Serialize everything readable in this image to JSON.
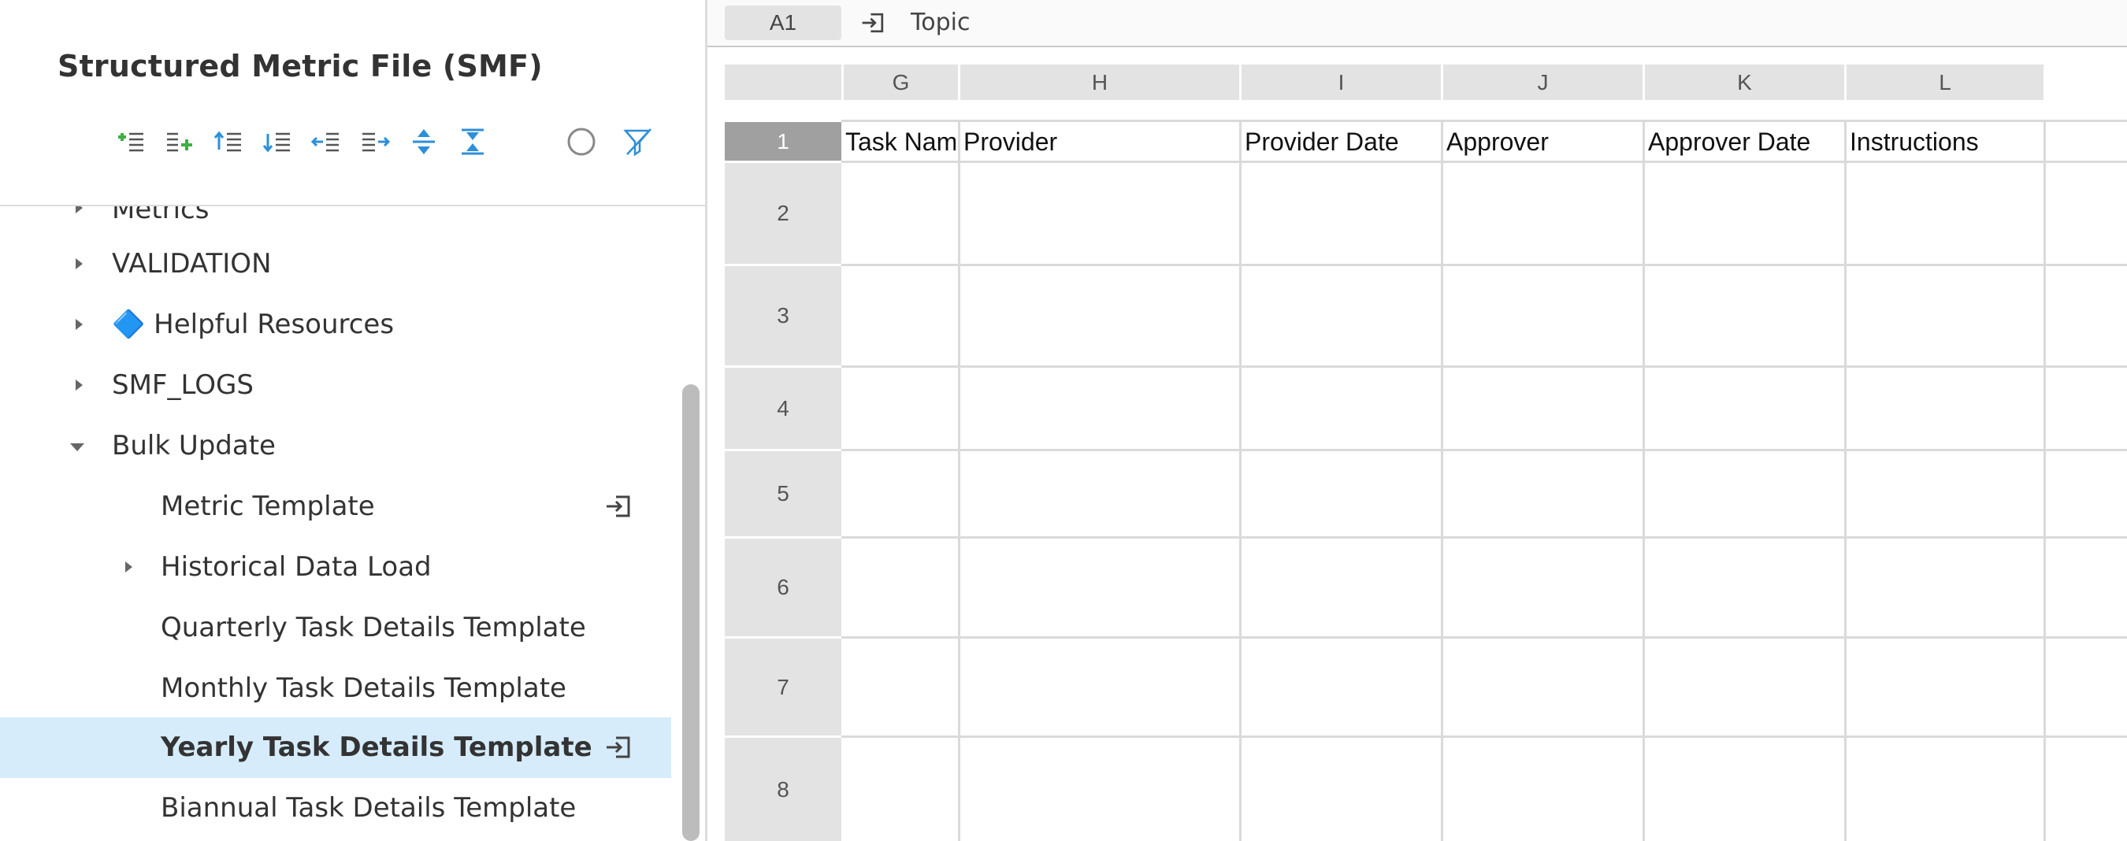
{
  "panel": {
    "title": "Structured Metric File (SMF)",
    "toolbar": [
      {
        "name": "add-child-icon"
      },
      {
        "name": "add-sibling-icon"
      },
      {
        "name": "insert-above-icon"
      },
      {
        "name": "insert-below-icon"
      },
      {
        "name": "outdent-icon"
      },
      {
        "name": "indent-icon"
      },
      {
        "name": "expand-all-icon"
      },
      {
        "name": "collapse-all-icon"
      },
      {
        "name": "circle-icon"
      },
      {
        "name": "filter-off-icon"
      }
    ]
  },
  "tree": {
    "items": [
      {
        "label": "Metrics",
        "caret": "right"
      },
      {
        "label": "VALIDATION",
        "caret": "right"
      },
      {
        "label": "🔷 Helpful Resources",
        "caret": "right"
      },
      {
        "label": "SMF_LOGS",
        "caret": "right"
      },
      {
        "label": "Bulk Update",
        "caret": "down"
      },
      {
        "label": "Metric Template",
        "caret": "none"
      },
      {
        "label": "Historical Data Load",
        "caret": "right"
      },
      {
        "label": "Quarterly Task Details Template",
        "caret": "none"
      },
      {
        "label": "Monthly Task Details Template",
        "caret": "none"
      },
      {
        "label": "Yearly Task Details Template",
        "caret": "none",
        "selected": true
      },
      {
        "label": "Biannual Task Details Template",
        "caret": "none"
      }
    ]
  },
  "sheet": {
    "cell_ref": "A1",
    "topic_label": "Topic",
    "columns": [
      "G",
      "H",
      "I",
      "J",
      "K",
      "L"
    ],
    "rows": [
      "1",
      "2",
      "3",
      "4",
      "5",
      "6",
      "7",
      "8"
    ],
    "header_row": [
      "Task Name",
      "Provider",
      "Provider Date",
      "Approver",
      "Approver Date",
      "Instructions"
    ]
  },
  "colors": {
    "selected_bg": "#d6ecfb",
    "accent_blue": "#2e8fd8",
    "accent_green": "#3cb043",
    "header_gray": "#e3e3e3"
  }
}
